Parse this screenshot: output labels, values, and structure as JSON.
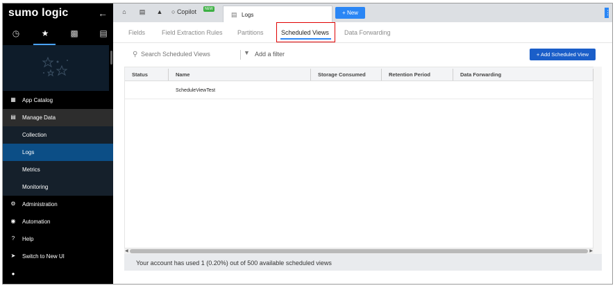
{
  "sidebar": {
    "brand": "sumo logic",
    "collapse_icon": "arrow-left-icon",
    "top_icons": [
      "recent-icon",
      "star-icon",
      "folder-person-icon",
      "folder-icon"
    ],
    "items": [
      {
        "label": "App Catalog",
        "icon": "grid-icon"
      },
      {
        "label": "Manage Data",
        "icon": "document-icon"
      },
      {
        "label": "Collection",
        "icon": ""
      },
      {
        "label": "Logs",
        "icon": ""
      },
      {
        "label": "Metrics",
        "icon": ""
      },
      {
        "label": "Monitoring",
        "icon": ""
      },
      {
        "label": "Administration",
        "icon": "gear-icon"
      },
      {
        "label": "Automation",
        "icon": "automation-icon"
      },
      {
        "label": "Help",
        "icon": "help-icon"
      },
      {
        "label": "Switch to New UI",
        "icon": "rocket-icon"
      }
    ]
  },
  "topbar": {
    "icons": [
      "home-icon",
      "folder-icon",
      "bell-icon"
    ],
    "copilot_label": "Copilot",
    "copilot_badge": "NEW",
    "active_tab": "Logs",
    "new_button": "+ New"
  },
  "subtabs": [
    "Fields",
    "Field Extraction Rules",
    "Partitions",
    "Scheduled Views",
    "Data Forwarding"
  ],
  "filterbar": {
    "search_placeholder": "Search Scheduled Views",
    "filter_label": "Add a filter",
    "add_button": "+ Add Scheduled View"
  },
  "table": {
    "columns": [
      "Status",
      "Name",
      "Storage Consumed",
      "Retention Period",
      "Data Forwarding"
    ],
    "rows": [
      {
        "status": "",
        "name": "ScheduleViewTest",
        "storage": "",
        "retention": "",
        "forwarding": ""
      }
    ]
  },
  "footer": {
    "message": "Your account has used 1 (0.20%) out of 500 available scheduled views"
  },
  "colors": {
    "accent": "#2a86f5",
    "primary_button": "#1a5ec9",
    "selected_nav": "#0c4e86",
    "highlight_box": "#e00000",
    "new_badge": "#3cb043"
  }
}
